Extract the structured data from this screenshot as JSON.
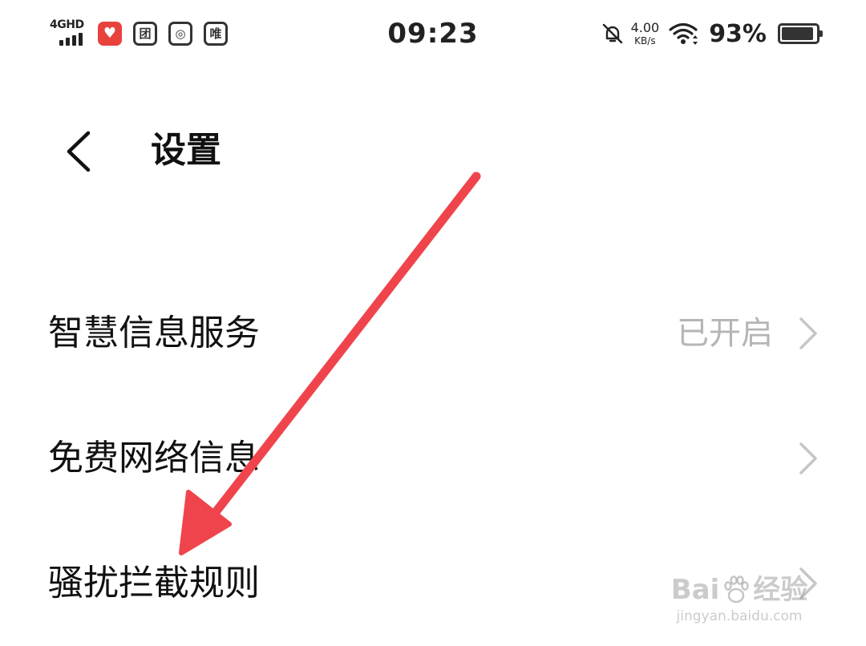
{
  "status_bar": {
    "network": "4GHD",
    "signal_level": 4,
    "app_icons": [
      {
        "name": "heart-app-icon",
        "glyph": "♥"
      },
      {
        "name": "tuan-app-icon",
        "glyph": "团"
      },
      {
        "name": "camera-app-icon",
        "glyph": "◎"
      },
      {
        "name": "wei-app-icon",
        "glyph": "唯"
      }
    ],
    "time": "09:23",
    "net_speed": "4.00",
    "net_speed_unit": "KB/s",
    "battery_percent": "93%",
    "battery_level": 0.93
  },
  "header": {
    "title": "设置"
  },
  "settings": {
    "items": [
      {
        "label": "智慧信息服务",
        "value": "已开启"
      },
      {
        "label": "免费网络信息",
        "value": ""
      },
      {
        "label": "骚扰拦截规则",
        "value": ""
      }
    ]
  },
  "annotation": {
    "color": "#f0444c"
  },
  "watermark": {
    "brand_left": "Bai",
    "brand_right": "经验",
    "url": "jingyan.baidu.com"
  }
}
